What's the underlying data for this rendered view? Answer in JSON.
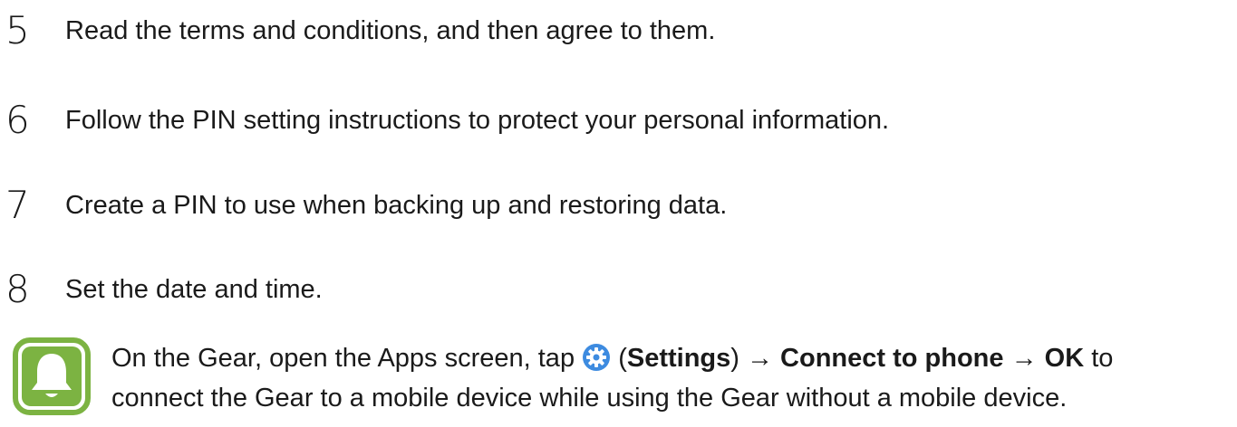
{
  "steps": [
    {
      "number": "5",
      "text": "Read the terms and conditions, and then agree to them."
    },
    {
      "number": "6",
      "text": "Follow the PIN setting instructions to protect your personal information."
    },
    {
      "number": "7",
      "text": "Create a PIN to use when backing up and restoring data."
    },
    {
      "number": "8",
      "text": "Set the date and time."
    }
  ],
  "note": {
    "icon": "bell-icon",
    "icon_color": "#7cb342",
    "line1": {
      "before_icon": "On the Gear, open the Apps screen, tap ",
      "settings_icon": "settings-gear-icon",
      "settings_icon_color": "#3d8be0",
      "open_paren": " (",
      "settings_label": "Settings",
      "close_paren_arrow": ") → ",
      "connect_label": "Connect to phone",
      "arrow": " → ",
      "ok_label": "OK",
      "after": " to"
    },
    "line2": "connect the Gear to a mobile device while using the Gear without a mobile device."
  }
}
